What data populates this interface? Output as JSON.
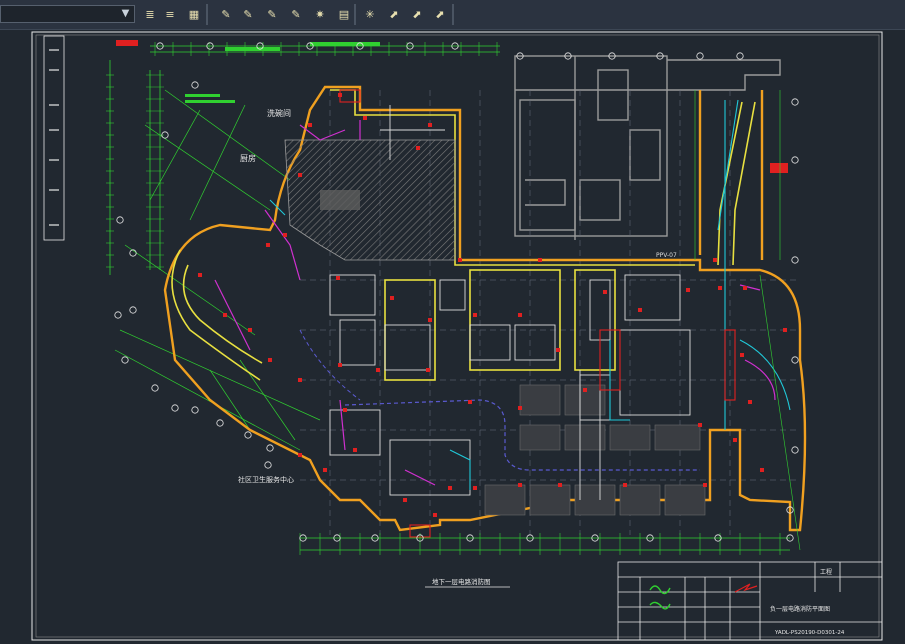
{
  "toolbar": {
    "layer_dropdown_value": "",
    "buttons": [
      {
        "name": "layer-stack-icon",
        "glyph": "≣"
      },
      {
        "name": "layer-previous-icon",
        "glyph": "≡"
      },
      {
        "name": "layer-states-icon",
        "glyph": "▦"
      },
      {
        "name": "layer-isolate-icon",
        "glyph": "✎"
      },
      {
        "name": "layer-unisolate-icon",
        "glyph": "✎"
      },
      {
        "name": "layer-off-icon",
        "glyph": "✎"
      },
      {
        "name": "layer-freeze-icon",
        "glyph": "✎"
      },
      {
        "name": "layer-lock-icon",
        "glyph": "✷"
      },
      {
        "name": "layer-unlock-icon",
        "glyph": "▤"
      },
      {
        "name": "layer-walk-icon",
        "glyph": "✳"
      },
      {
        "name": "layer-match-icon",
        "glyph": "⬈"
      },
      {
        "name": "layer-change-icon",
        "glyph": "⬈"
      },
      {
        "name": "layer-merge-icon",
        "glyph": "⬈"
      }
    ]
  },
  "drawing": {
    "labels": {
      "room_a": "洗碗间",
      "room_b": "厨房",
      "room_c": "社区卫生服务中心",
      "plan_title": "地下一层电路消防图",
      "ppv_label": "PPV-07",
      "title_block_project": "工程",
      "title_block_drawing": "负一层电路消防平面图",
      "drawing_number": "YADL-PS20190-D0301-24"
    }
  },
  "colors": {
    "background": "#212830",
    "toolbar": "#2b3340",
    "wall_orange": "#f0a020",
    "grid_green": "#30d030",
    "cyan": "#20c8d8",
    "magenta": "#d030d0",
    "red": "#e02020",
    "yellow": "#e8e040",
    "white": "#e8e8e8",
    "gray": "#8c8c8c"
  }
}
